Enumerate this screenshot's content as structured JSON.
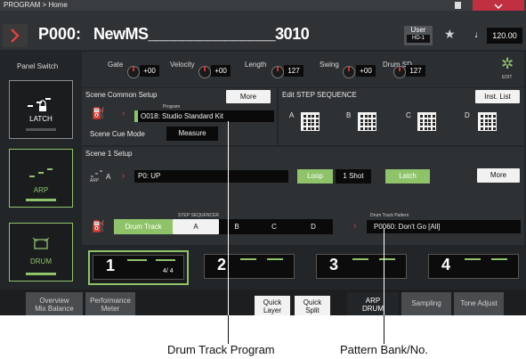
{
  "breadcrumb": "PROGRAM > Home",
  "program": {
    "number": "P000:",
    "name": "NewMS_______________3010",
    "bank_label": "User",
    "bank_sub": "HD-1",
    "tempo": "120.00"
  },
  "panel_switch": {
    "title": "Panel Switch",
    "latch_label": "LATCH",
    "arp_label": "ARP",
    "drum_label": "DRUM"
  },
  "params": {
    "gate": {
      "label": "Gate",
      "value": "+00"
    },
    "velocity": {
      "label": "Velocity",
      "value": "+00"
    },
    "length": {
      "label": "Length",
      "value": "127"
    },
    "swing": {
      "label": "Swing",
      "value": "+00"
    },
    "drum_sd": {
      "label": "Drum SD",
      "value": "127"
    },
    "edit_label": "EDIT"
  },
  "scene_common": {
    "title": "Scene Common Setup",
    "more": "More",
    "program_caption": "Program",
    "program_value": "O018: Studio Standard Kit",
    "cue_mode_label": "Scene Cue Mode",
    "cue_mode_value": "Measure"
  },
  "step_sequence": {
    "title": "Edit STEP SEQUENCE",
    "inst_list": "Inst. List",
    "slots": [
      "A",
      "B",
      "C",
      "D"
    ]
  },
  "scene1": {
    "title": "Scene 1 Setup",
    "arp_tag": "ARP",
    "arp_slot": "A",
    "arp_pattern": "P0: UP",
    "loop": "Loop",
    "one_shot": "1 Shot",
    "latch": "Latch",
    "more": "More",
    "step_seq_caption": "STEP SEQUENCER",
    "drum_track": "Drum Track",
    "steps": [
      "A",
      "B",
      "C",
      "D"
    ],
    "pattern_caption": "Drum Track Pattern",
    "pattern_value": "P0060: Don't Go [All]"
  },
  "scenes": [
    {
      "num": "1",
      "meter": "4/ 4"
    },
    {
      "num": "2",
      "meter": ""
    },
    {
      "num": "3",
      "meter": ""
    },
    {
      "num": "4",
      "meter": ""
    }
  ],
  "bottom_tabs": [
    {
      "l1": "Overview",
      "l2": "Mix Balance"
    },
    {
      "l1": "Performance",
      "l2": "Meter"
    },
    {
      "l1": "Quick",
      "l2": "Layer"
    },
    {
      "l1": "Quick",
      "l2": "Split"
    },
    {
      "l1": "ARP",
      "l2": "DRUM"
    },
    {
      "l1": "Sampling",
      "l2": ""
    },
    {
      "l1": "Tone Adjust",
      "l2": ""
    }
  ],
  "callouts": {
    "left": "Drum Track Program",
    "right": "Pattern Bank/No."
  },
  "colors": {
    "accent_green": "#8fc36a",
    "accent_red": "#d04040",
    "background": "#232629"
  }
}
